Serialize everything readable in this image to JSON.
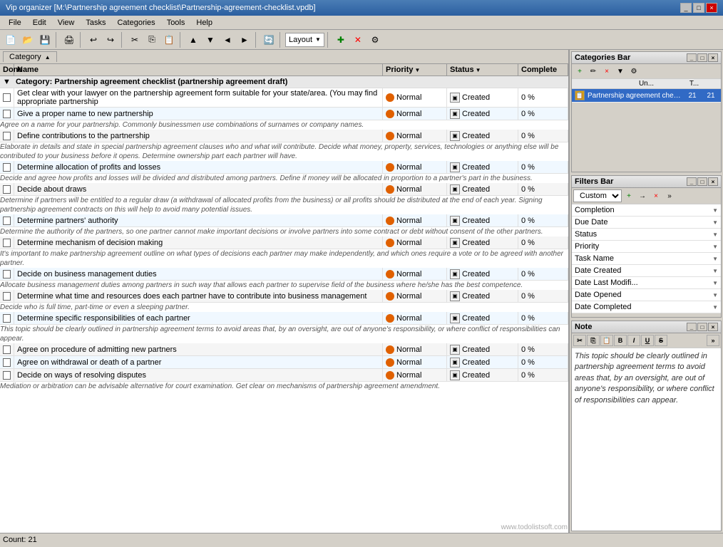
{
  "titleBar": {
    "title": "Vip organizer [M:\\Partnership agreement checklist\\Partnership-agreement-checklist.vpdb]",
    "buttons": [
      "_",
      "□",
      "×"
    ]
  },
  "menuBar": {
    "items": [
      "File",
      "Edit",
      "View",
      "Tasks",
      "Categories",
      "Tools",
      "Help"
    ]
  },
  "toolbar": {
    "layoutLabel": "Layout"
  },
  "categoryTab": {
    "label": "Category"
  },
  "tableHeaders": {
    "done": "Done",
    "name": "Name",
    "priority": "Priority",
    "status": "Status",
    "complete": "Complete"
  },
  "categoryRow": {
    "label": "Category: Partnership agreement checklist (partnership agreement draft)"
  },
  "tasks": [
    {
      "id": 1,
      "name": "Get clear with your lawyer on the partnership agreement form suitable for your state/area. (You may find appropriate partnership",
      "priority": "Normal",
      "status": "Created",
      "complete": "0 %",
      "note": ""
    },
    {
      "id": 2,
      "name": "Give a proper name to new partnership",
      "priority": "Normal",
      "status": "Created",
      "complete": "0 %",
      "note": "Agree on a name for your partnership. Commonly businessmen use combinations of surnames or company names."
    },
    {
      "id": 3,
      "name": "Define contributions to the partnership",
      "priority": "Normal",
      "status": "Created",
      "complete": "0 %",
      "note": "Elaborate in details and state in special partnership agreement clauses who and what will contribute. Decide what money, property, services, technologies or anything else will be contributed to your business before it opens. Determine ownership part each partner will have."
    },
    {
      "id": 4,
      "name": "Determine allocation of profits and losses",
      "priority": "Normal",
      "status": "Created",
      "complete": "0 %",
      "note": "Decide and agree how profits and losses will be divided and distributed among partners. Define if money will be allocated in proportion to a partner's part in the business."
    },
    {
      "id": 5,
      "name": "Decide about draws",
      "priority": "Normal",
      "status": "Created",
      "complete": "0 %",
      "note": "Determine if partners will be entitled to a regular draw (a withdrawal of allocated profits from the business) or all profits should be distributed at the end of each year.\nSigning partnership agreement contracts on this will help to avoid many potential issues."
    },
    {
      "id": 6,
      "name": "Determine partners' authority",
      "priority": "Normal",
      "status": "Created",
      "complete": "0 %",
      "note": "Determine the authority of the partners, so one partner cannot make important decisions or involve partners into some contract or debt without consent of the other partners."
    },
    {
      "id": 7,
      "name": "Determine mechanism of decision making",
      "priority": "Normal",
      "status": "Created",
      "complete": "0 %",
      "note": "It's important to make partnership agreement outline on what types of decisions each partner may make independently, and which ones require a vote or to be agreed with another partner."
    },
    {
      "id": 8,
      "name": "Decide on business management duties",
      "priority": "Normal",
      "status": "Created",
      "complete": "0 %",
      "note": "Allocate business management duties among partners in such way that allows each partner to supervise field of the business where he/she has the best competence."
    },
    {
      "id": 9,
      "name": "Determine what time and resources does each partner have to contribute into business management",
      "priority": "Normal",
      "status": "Created",
      "complete": "0 %",
      "note": "Decide who is full time, part-time or even a sleeping partner."
    },
    {
      "id": 10,
      "name": "Determine specific responsibilities of each partner",
      "priority": "Normal",
      "status": "Created",
      "complete": "0 %",
      "note": "This topic should be clearly outlined in partnership agreement terms to avoid areas that, by an oversight, are out of anyone's responsibility, or where conflict of responsibilities can appear."
    },
    {
      "id": 11,
      "name": "Agree on procedure of admitting new partners",
      "priority": "Normal",
      "status": "Created",
      "complete": "0 %",
      "note": ""
    },
    {
      "id": 12,
      "name": "Agree on withdrawal or death of a partner",
      "priority": "Normal",
      "status": "Created",
      "complete": "0 %",
      "note": ""
    },
    {
      "id": 13,
      "name": "Decide on ways of resolving disputes",
      "priority": "Normal",
      "status": "Created",
      "complete": "0 %",
      "note": "Mediation or arbitration can be advisable alternative for court examination. Get clear on mechanisms of partnership agreement amendment."
    }
  ],
  "statusBar": {
    "count": "Count: 21"
  },
  "categoriesPanel": {
    "title": "Categories Bar",
    "colHeaders": [
      "Un...",
      "T..."
    ],
    "items": [
      {
        "name": "Partnership agreement checklist (",
        "un": "21",
        "t": "21"
      }
    ]
  },
  "filtersPanel": {
    "title": "Filters Bar",
    "dropdown": "Custom",
    "filters": [
      "Completion",
      "Due Date",
      "Status",
      "Priority",
      "Task Name",
      "Date Created",
      "Date Last Modifi...",
      "Date Opened",
      "Date Completed"
    ]
  },
  "notePanel": {
    "title": "Note",
    "content": "This topic should be clearly outlined in partnership agreement terms to avoid areas that, by an oversight, are out of anyone's responsibility, or where conflict of responsibilities can appear."
  },
  "watermark": "www.todolistsoft.com"
}
